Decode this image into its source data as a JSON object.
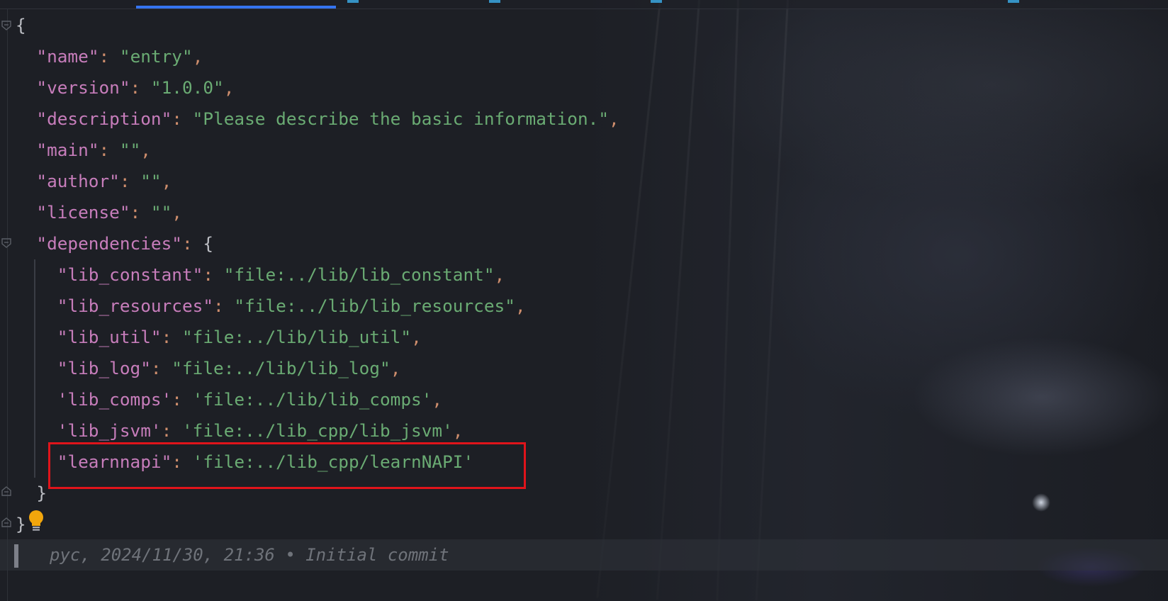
{
  "editor": {
    "lines": [
      {
        "indent": "",
        "key": "",
        "quote": "",
        "colon": "",
        "value": "",
        "vquote": "",
        "comma": "",
        "open": "{",
        "close": ""
      },
      {
        "indent": "  ",
        "key": "name",
        "quote": "\"",
        "colon": ": ",
        "value": "entry",
        "vquote": "\"",
        "comma": ",",
        "open": "",
        "close": ""
      },
      {
        "indent": "  ",
        "key": "version",
        "quote": "\"",
        "colon": ": ",
        "value": "1.0.0",
        "vquote": "\"",
        "comma": ",",
        "open": "",
        "close": ""
      },
      {
        "indent": "  ",
        "key": "description",
        "quote": "\"",
        "colon": ": ",
        "value": "Please describe the basic information.",
        "vquote": "\"",
        "comma": ",",
        "open": "",
        "close": ""
      },
      {
        "indent": "  ",
        "key": "main",
        "quote": "\"",
        "colon": ": ",
        "value": "",
        "vquote": "\"",
        "comma": ",",
        "open": "",
        "close": ""
      },
      {
        "indent": "  ",
        "key": "author",
        "quote": "\"",
        "colon": ": ",
        "value": "",
        "vquote": "\"",
        "comma": ",",
        "open": "",
        "close": ""
      },
      {
        "indent": "  ",
        "key": "license",
        "quote": "\"",
        "colon": ": ",
        "value": "",
        "vquote": "\"",
        "comma": ",",
        "open": "",
        "close": ""
      },
      {
        "indent": "  ",
        "key": "dependencies",
        "quote": "\"",
        "colon": ": ",
        "value": "",
        "vquote": "",
        "comma": "",
        "open": "{",
        "close": ""
      },
      {
        "indent": "    ",
        "key": "lib_constant",
        "quote": "\"",
        "colon": ": ",
        "value": "file:../lib/lib_constant",
        "vquote": "\"",
        "comma": ",",
        "open": "",
        "close": ""
      },
      {
        "indent": "    ",
        "key": "lib_resources",
        "quote": "\"",
        "colon": ": ",
        "value": "file:../lib/lib_resources",
        "vquote": "\"",
        "comma": ",",
        "open": "",
        "close": ""
      },
      {
        "indent": "    ",
        "key": "lib_util",
        "quote": "\"",
        "colon": ": ",
        "value": "file:../lib/lib_util",
        "vquote": "\"",
        "comma": ",",
        "open": "",
        "close": ""
      },
      {
        "indent": "    ",
        "key": "lib_log",
        "quote": "\"",
        "colon": ": ",
        "value": "file:../lib/lib_log",
        "vquote": "\"",
        "comma": ",",
        "open": "",
        "close": ""
      },
      {
        "indent": "    ",
        "key": "lib_comps",
        "quote": "'",
        "colon": ": ",
        "value": "file:../lib/lib_comps",
        "vquote": "'",
        "comma": ",",
        "open": "",
        "close": ""
      },
      {
        "indent": "    ",
        "key": "lib_jsvm",
        "quote": "'",
        "colon": ": ",
        "value": "file:../lib_cpp/lib_jsvm",
        "vquote": "'",
        "comma": ",",
        "open": "",
        "close": ""
      },
      {
        "indent": "    ",
        "key": "learnnapi",
        "quote": "\"",
        "colon": ": ",
        "value": "file:../lib_cpp/learnNAPI",
        "vquote": "'",
        "comma": "",
        "open": "",
        "close": ""
      },
      {
        "indent": "  ",
        "key": "",
        "quote": "",
        "colon": "",
        "value": "",
        "vquote": "",
        "comma": "",
        "open": "",
        "close": "}"
      },
      {
        "indent": "",
        "key": "",
        "quote": "",
        "colon": "",
        "value": "",
        "vquote": "",
        "comma": "",
        "open": "",
        "close": "}"
      }
    ]
  },
  "blame": {
    "text": "pyc, 2024/11/30, 21:36 • Initial commit"
  },
  "colors": {
    "key": "#c77dbb",
    "string": "#6aab73",
    "punctuation": "#cf8e6d",
    "text": "#bcbec4",
    "highlight_border": "#e0141b",
    "tab_accent": "#3592c4"
  },
  "icons": {
    "fold": "fold-marker-icon",
    "intention": "lightbulb-icon"
  }
}
